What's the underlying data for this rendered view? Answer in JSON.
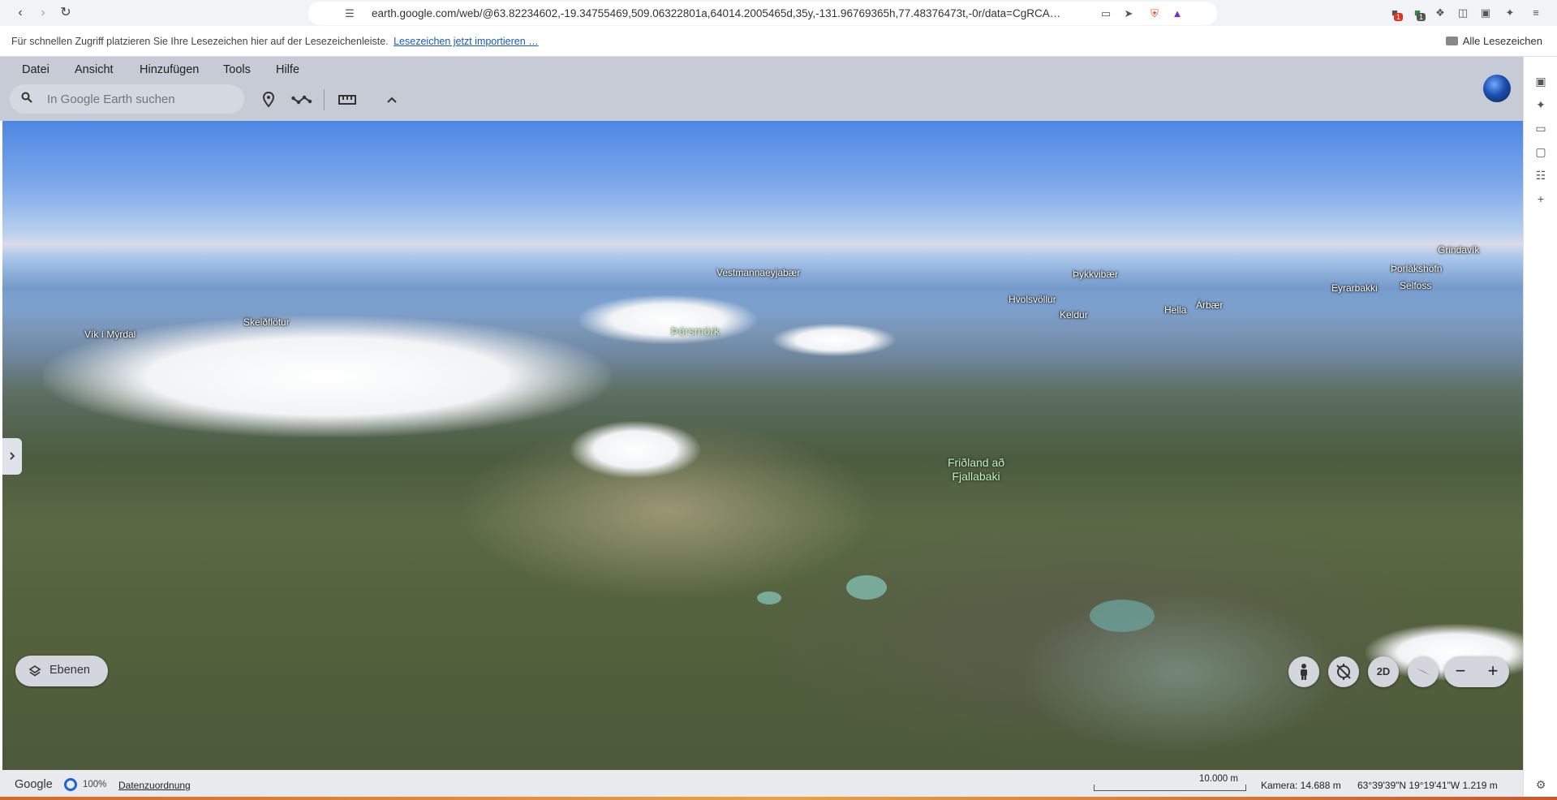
{
  "browser": {
    "url": "earth.google.com/web/@63.82234602,-19.34755469,509.06322801a,64014.2005465d,35y,-131.96769365h,77.48376473t,-0r/data=CgRCA…",
    "bookmarks_hint": "Für schnellen Zugriff platzieren Sie Ihre Lesezeichen hier auf der Lesezeichenleiste.",
    "bookmarks_import_link": "Lesezeichen jetzt importieren …",
    "all_bookmarks": "Alle Lesezeichen",
    "badge_1": "1",
    "badge_2": "1"
  },
  "menu": {
    "items": [
      "Datei",
      "Ansicht",
      "Hinzufügen",
      "Tools",
      "Hilfe"
    ]
  },
  "search": {
    "placeholder": "In Google Earth suchen"
  },
  "map_labels": {
    "places": [
      "Vík í Mýrdal",
      "Skeiðflötur",
      "Vestmannaeyjabær",
      "Þykkvibær",
      "Hvolsvöllur",
      "Keldur",
      "Hella",
      "Árbær",
      "Eyrarbakki",
      "Selfoss",
      "Þorlákshöfn",
      "Grindavík"
    ],
    "parks": [
      "Þórsmörk",
      "Friðland að",
      "Fjallabaki"
    ]
  },
  "controls": {
    "layers_label": "Ebenen",
    "mode_2d": "2D",
    "zoom_out": "−",
    "zoom_in": "+"
  },
  "status": {
    "logo": "Google",
    "loading": "100%",
    "attribution": "Datenzuordnung",
    "scale": "10.000 m",
    "camera": "Kamera: 14.688 m",
    "coords": "63°39'39\"N 19°19'41\"W   1.219 m"
  },
  "colors": {
    "header_bg": "#c6cbd6",
    "link_blue": "#1a56c9",
    "park_label": "#bff3bf"
  }
}
